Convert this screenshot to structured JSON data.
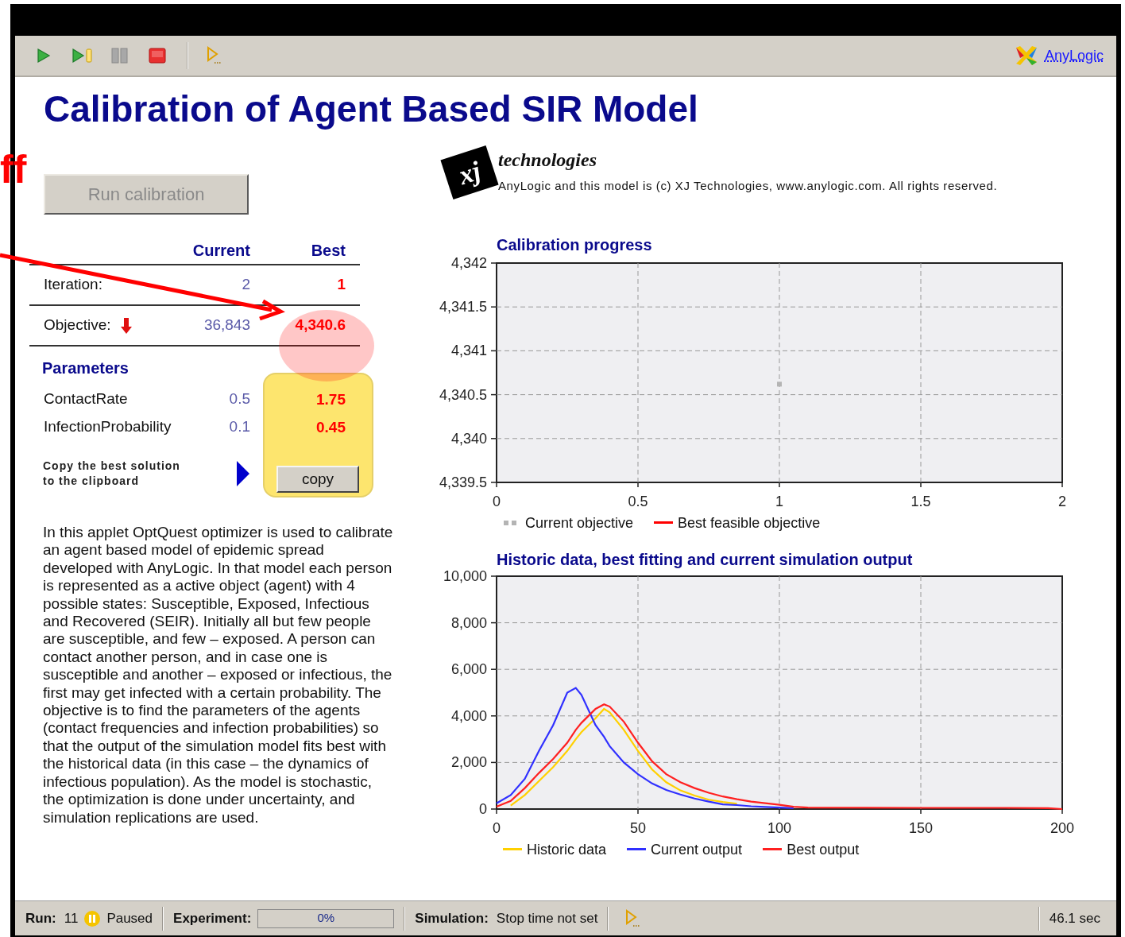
{
  "annotation": {
    "label": "ff"
  },
  "toolbar": {
    "buttons": [
      {
        "kind": "run"
      },
      {
        "kind": "step"
      },
      {
        "kind": "pause"
      },
      {
        "kind": "stop"
      },
      {
        "kind": "separator"
      },
      {
        "kind": "run_until"
      }
    ],
    "link": "AnyLogic"
  },
  "title": "Calibration of Agent Based SIR Model",
  "run_button": {
    "label": "Run calibration",
    "disabled": true
  },
  "results": {
    "columns": [
      "Current",
      "Best"
    ],
    "rows": [
      {
        "kind": "plain",
        "label": "Iteration:",
        "current": "2",
        "best": "1"
      },
      {
        "kind": "objective",
        "label": "Objective:",
        "current": "36,843",
        "best": "4,340.6"
      }
    ]
  },
  "parameters": {
    "heading": "Parameters",
    "rows": [
      {
        "name": "ContactRate",
        "current": "0.5",
        "best": "1.75"
      },
      {
        "name": "InfectionProbability",
        "current": "0.1",
        "best": "0.45"
      }
    ],
    "copy_caption": [
      "Copy the best solution",
      "to the clipboard"
    ],
    "copy_button": "copy"
  },
  "description": "In this applet OptQuest optimizer is used to calibrate an agent based model of epidemic spread developed with AnyLogic. In that model each person is represented as a active object (agent) with 4 possible states: Susceptible, Exposed, Infectious and Recovered (SEIR). Initially all but few people are susceptible, and few – exposed. A person can contact another person, and in case one is susceptible and another – exposed or infectious, the first may get infected with a certain probability. The objective is to find the parameters of the agents (contact frequencies and infection probabilities) so that the output of the simulation model fits best with the historical data (in this case – the dynamics of infectious population). As the model is stochastic, the optimization is done under uncertainty, and simulation replications are used.",
  "logo": {
    "mark": "xj",
    "wordmark": "technologies",
    "notice": "AnyLogic and this model is (c) XJ Technologies, www.anylogic.com. All rights reserved."
  },
  "calibration_progress": {
    "chart_data": {
      "type": "line",
      "title": "Calibration progress",
      "grid": true,
      "x": [
        1
      ],
      "xlim": [
        0,
        2
      ],
      "ylim": [
        4339.5,
        4342
      ],
      "xticks": [
        0,
        0.5,
        1,
        1.5,
        2
      ],
      "yticks": [
        {
          "value": 4342,
          "label": "4,342"
        },
        {
          "value": 4341.5,
          "label": "4,341.5"
        },
        {
          "value": 4341,
          "label": "4,341"
        },
        {
          "value": 4340.5,
          "label": "4,340.5"
        },
        {
          "value": 4340,
          "label": "4,340"
        },
        {
          "value": 4339.5,
          "label": "4,339.5"
        }
      ],
      "series": [
        {
          "name": "Current objective",
          "color": "#b4b4b4",
          "marker": "square",
          "values": [
            4340.62
          ]
        },
        {
          "name": "Best feasible objective",
          "color": "#ff0000",
          "values": [
            null
          ]
        }
      ]
    }
  },
  "historic_chart": {
    "chart_data": {
      "type": "line",
      "title": "Historic data, best fitting and current simulation output",
      "grid": true,
      "x": [
        0,
        5,
        10,
        15,
        20,
        25,
        28,
        30,
        35,
        38,
        40,
        45,
        50,
        55,
        60,
        65,
        70,
        75,
        80,
        85,
        90,
        95,
        100,
        105,
        110,
        150,
        180,
        195,
        200
      ],
      "xlim": [
        0,
        200
      ],
      "ylim": [
        0,
        10000
      ],
      "xticks": [
        0,
        50,
        100,
        150,
        200
      ],
      "yticks": [
        {
          "value": 0,
          "label": "0"
        },
        {
          "value": 2000,
          "label": "2,000"
        },
        {
          "value": 4000,
          "label": "4,000"
        },
        {
          "value": 6000,
          "label": "6,000"
        },
        {
          "value": 8000,
          "label": "8,000"
        },
        {
          "value": 10000,
          "label": "10,000"
        }
      ],
      "series": [
        {
          "name": "Historic data",
          "color": "#ffd000",
          "values": [
            null,
            150,
            600,
            1200,
            1800,
            2500,
            3000,
            3300,
            3900,
            4300,
            4150,
            3400,
            2500,
            1700,
            1150,
            800,
            580,
            400,
            300,
            230,
            null,
            null,
            null,
            null,
            null,
            null,
            null,
            null,
            null
          ]
        },
        {
          "name": "Current output",
          "color": "#3030ff",
          "values": [
            250,
            600,
            1300,
            2500,
            3600,
            5000,
            5200,
            4900,
            3600,
            3100,
            2700,
            2000,
            1500,
            1100,
            820,
            620,
            450,
            320,
            200,
            170,
            120,
            90,
            60,
            40,
            null,
            null,
            null,
            null,
            null
          ]
        },
        {
          "name": "Best output",
          "color": "#ff2020",
          "values": [
            100,
            350,
            900,
            1550,
            2150,
            2850,
            3400,
            3700,
            4300,
            4500,
            4400,
            3750,
            2850,
            2050,
            1500,
            1150,
            900,
            700,
            540,
            420,
            320,
            250,
            180,
            100,
            60,
            50,
            50,
            40,
            0
          ]
        }
      ]
    }
  },
  "status_bar": {
    "run_label": "Run:",
    "run_number": "11",
    "run_state": "Paused",
    "paused": true,
    "experiment_label": "Experiment:",
    "progress": {
      "level": 0,
      "text": "0%"
    },
    "simulation_label": "Simulation:",
    "simulation_state": "Stop time not set",
    "time": "46.1 sec"
  }
}
